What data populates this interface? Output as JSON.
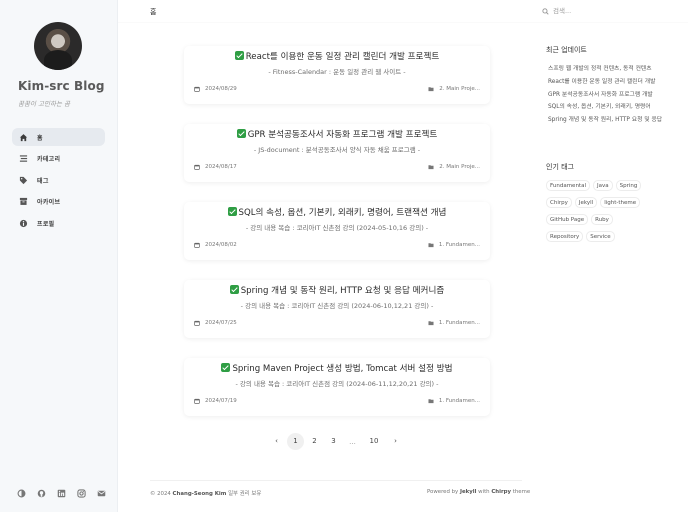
{
  "sidebar": {
    "title": "Kim-src Blog",
    "subtitle": "꿈꿈이 고민하는 곰",
    "nav": [
      {
        "label": "홈",
        "icon": "home-icon"
      },
      {
        "label": "카테고리",
        "icon": "stream-icon"
      },
      {
        "label": "태그",
        "icon": "tags-icon"
      },
      {
        "label": "아카이브",
        "icon": "archive-icon"
      },
      {
        "label": "프로필",
        "icon": "info-icon"
      }
    ],
    "bottom_icons": [
      "theme-toggle-icon",
      "github-icon",
      "linkedin-icon",
      "instagram-icon",
      "email-icon"
    ]
  },
  "topbar": {
    "breadcrumb": "홈",
    "search_placeholder": "검색..."
  },
  "posts": [
    {
      "title": "React를 이용한 운동 일정 관리 캘린더 개발 프로젝트",
      "desc": "- Fitness-Calendar : 운동 일정 관리 웹 사이트 -",
      "date": "2024/08/29",
      "category": "2. Main Proje..."
    },
    {
      "title": "GPR 분석공동조사서 자동화 프로그램 개발 프로젝트",
      "desc": "- JS-document : 분석공동조사서 양식 자동 채움 프로그램 -",
      "date": "2024/08/17",
      "category": "2. Main Proje..."
    },
    {
      "title": "SQL의 속성, 옵션, 기본키, 외래키, 명령어, 트랜잭션 개념",
      "desc": "- 강의 내용 복습 : 코리아IT 신촌점 강의 (2024-05-10,16 강의) -",
      "date": "2024/08/02",
      "category": "1. Fundamen..."
    },
    {
      "title": "Spring 개념 및 동작 원리, HTTP 요청 및 응답 메커니즘",
      "desc": "- 강의 내용 복습 : 코리아IT 신촌점 강의 (2024-06-10,12,21 강의) -",
      "date": "2024/07/25",
      "category": "1. Fundamen..."
    },
    {
      "title": "Spring Maven Project 생성 방법, Tomcat 서버 설정 방법",
      "desc": "- 강의 내용 복습 : 코리아IT 신촌점 강의 (2024-06-11,12,20,21 강의) -",
      "date": "2024/07/19",
      "category": "1. Fundamen..."
    }
  ],
  "pagination": {
    "prev": "‹",
    "pages": [
      "1",
      "2",
      "3"
    ],
    "ellipsis": "...",
    "last": "10",
    "next": "›",
    "current": "1"
  },
  "footer": {
    "copyright_prefix": "© 2024",
    "author": "Chang-Seong Kim",
    "rights": "일부 권리 보유",
    "powered_prefix": "Powered by",
    "engine": "Jekyll",
    "with": "with",
    "theme_name": "Chirpy",
    "theme_suffix": "theme"
  },
  "panel": {
    "recent_heading": "최근 업데이트",
    "recent_items": [
      "스프링 웹 개발의 정적 컨텐츠, 동적 컨텐츠",
      "React를 이용한 운동 일정 관리 캘린더 개발",
      "GPR 분석공동조사서 자동화 프로그램 개발",
      "SQL의 속성, 옵션, 기본키, 외래키, 명령어",
      "Spring 개념 및 동작 원리, HTTP 요청 및 응답"
    ],
    "tags_heading": "인기 태그",
    "tags": [
      "Fundamental",
      "Java",
      "Spring",
      "Chirpy",
      "Jekyll",
      "light-theme",
      "GitHub Page",
      "Ruby",
      "Repository",
      "Service"
    ]
  },
  "colors": {
    "check_green": "#2f9e44",
    "sidebar_bg": "#f6f8fa",
    "active_nav_bg": "#e6eaef"
  }
}
